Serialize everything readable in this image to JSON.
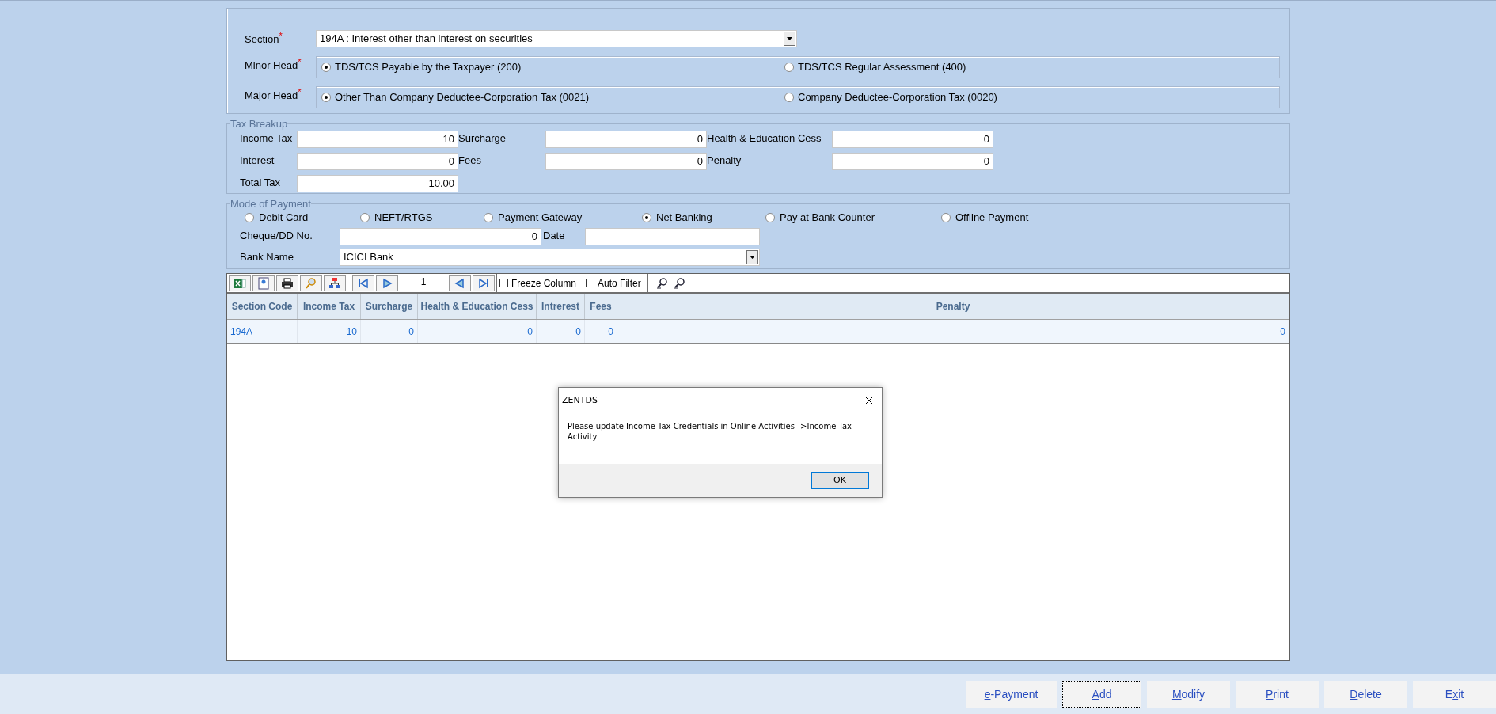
{
  "section": {
    "label": "Section",
    "required_mark": "*",
    "value": "194A : Interest other than interest on securities"
  },
  "minor_head": {
    "label": "Minor Head",
    "required_mark": "*",
    "options": [
      {
        "label": "TDS/TCS Payable by the Taxpayer (200)",
        "selected": true
      },
      {
        "label": "TDS/TCS Regular Assessment (400)",
        "selected": false
      }
    ]
  },
  "major_head": {
    "label": "Major Head",
    "required_mark": "*",
    "options": [
      {
        "label": "Other Than Company Deductee-Corporation Tax (0021)",
        "selected": true
      },
      {
        "label": "Company Deductee-Corporation Tax (0020)",
        "selected": false
      }
    ]
  },
  "tax_breakup": {
    "legend": "Tax Breakup",
    "fields": [
      {
        "label": "Income Tax",
        "value": "10"
      },
      {
        "label": "Surcharge",
        "value": "0"
      },
      {
        "label": "Health & Education Cess",
        "value": "0"
      },
      {
        "label": "Interest",
        "value": "0"
      },
      {
        "label": "Fees",
        "value": "0"
      },
      {
        "label": "Penalty",
        "value": "0"
      },
      {
        "label": "Total Tax",
        "value": "10.00"
      }
    ]
  },
  "mode_of_payment": {
    "legend": "Mode of Payment",
    "options": [
      {
        "label": "Debit Card",
        "selected": false
      },
      {
        "label": "NEFT/RTGS",
        "selected": false
      },
      {
        "label": "Payment Gateway",
        "selected": false
      },
      {
        "label": "Net Banking",
        "selected": true
      },
      {
        "label": "Pay at Bank Counter",
        "selected": false
      },
      {
        "label": "Offline Payment",
        "selected": false
      }
    ],
    "cheque": {
      "label": "Cheque/DD No.",
      "value": "0"
    },
    "date": {
      "label": "Date"
    },
    "bank": {
      "label": "Bank Name",
      "value": "ICICI Bank"
    }
  },
  "toolbar": {
    "page": "1",
    "checkboxes": [
      {
        "label": "Freeze Column",
        "checked": false
      },
      {
        "label": "Auto Filter",
        "checked": false
      }
    ]
  },
  "table": {
    "columns": [
      "Section Code",
      "Income Tax",
      "Surcharge",
      "Health & Education Cess",
      "Intrerest",
      "Fees",
      "Penalty"
    ],
    "rows": [
      [
        "194A",
        "10",
        "0",
        "0",
        "0",
        "0",
        "0"
      ]
    ]
  },
  "dialog": {
    "title": "ZENTDS",
    "message": "Please update Income Tax Credentials in Online Activities-->Income Tax Activity",
    "ok": "OK"
  },
  "buttons": [
    {
      "key": "e",
      "after": "-Payment",
      "focused": false
    },
    {
      "key": "A",
      "after": "dd",
      "focused": true
    },
    {
      "key": "M",
      "after": "odify",
      "focused": false
    },
    {
      "key": "P",
      "after": "rint",
      "focused": false
    },
    {
      "key": "D",
      "after": "elete",
      "focused": false
    },
    {
      "before": "E",
      "key": "x",
      "after": "it",
      "focused": false
    }
  ]
}
